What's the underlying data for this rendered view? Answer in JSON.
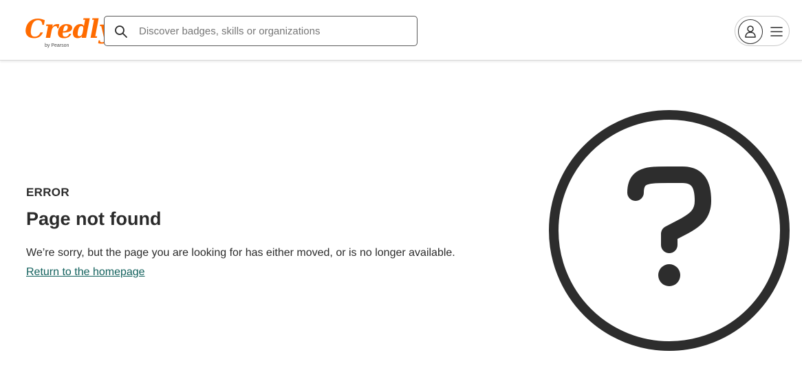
{
  "header": {
    "logo": {
      "wordmark": "Credly",
      "byline": "by Pearson",
      "color": "#ff6b00"
    },
    "search": {
      "placeholder": "Discover badges, skills or organizations",
      "value": "",
      "icon": "search-icon"
    },
    "user_menu": {
      "avatar_icon": "user-icon",
      "menu_icon": "hamburger-menu-icon"
    }
  },
  "main": {
    "eyebrow": "ERROR",
    "title": "Page not found",
    "message": "We’re sorry, but the page you are looking for has either moved, or is no longer available.",
    "link_label": "Return to the homepage",
    "link_color": "#11605c",
    "illustration_icon": "question-mark-circle-icon"
  }
}
